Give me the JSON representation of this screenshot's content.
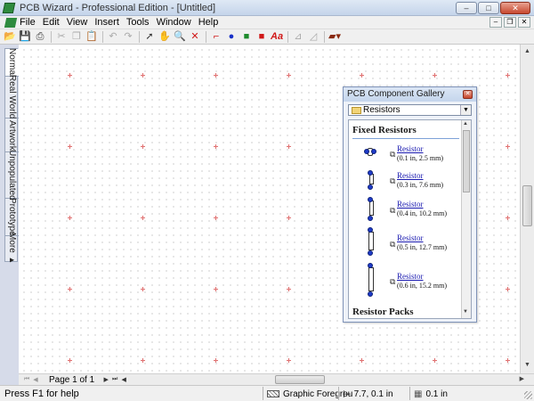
{
  "window": {
    "title": "PCB Wizard - Professional Edition - [Untitled]",
    "controls": [
      "–",
      "□",
      "✕"
    ]
  },
  "menu": {
    "items": [
      "File",
      "Edit",
      "View",
      "Insert",
      "Tools",
      "Window",
      "Help"
    ],
    "mdi_controls": [
      "–",
      "❐",
      "✕"
    ]
  },
  "toolbar": {
    "icons": [
      "open-icon",
      "save-icon",
      "print-icon",
      "cut-icon",
      "copy-icon",
      "paste-icon",
      "undo-icon",
      "redo-icon",
      "select-icon",
      "hand-icon",
      "zoom-icon",
      "delete-icon",
      "track-icon",
      "pad-icon",
      "square-pad-icon",
      "component-icon",
      "text-icon",
      "ruler-icon",
      "dimension-icon",
      "toolbox-icon"
    ]
  },
  "side_tabs": [
    "Normal",
    "Real World",
    "Artwork",
    "Unpopulated",
    "Prototype",
    "More ▸"
  ],
  "page_nav": {
    "label": "Page 1 of 1"
  },
  "status": {
    "help": "Press F1 for help",
    "layer": "Graphic Foregrou",
    "coords": "7.7, 0.1 in",
    "grid": "0.1 in"
  },
  "gallery": {
    "title": "PCB Component Gallery",
    "category": "Resistors",
    "sections": [
      {
        "heading": "Fixed Resistors",
        "items": [
          {
            "name": "Resistor",
            "size": "(0.1 in, 2.5 mm)"
          },
          {
            "name": "Resistor",
            "size": "(0.3 in, 7.6 mm)"
          },
          {
            "name": "Resistor",
            "size": "(0.4 in, 10.2 mm)"
          },
          {
            "name": "Resistor",
            "size": "(0.5 in, 12.7 mm)"
          },
          {
            "name": "Resistor",
            "size": "(0.6 in, 15.2 mm)"
          }
        ]
      },
      {
        "heading": "Resistor Packs",
        "items": []
      }
    ]
  },
  "colors": {
    "pad_blue": "#1e3bc8",
    "origin_cross": "#e07070",
    "link": "#1a1ab0"
  }
}
